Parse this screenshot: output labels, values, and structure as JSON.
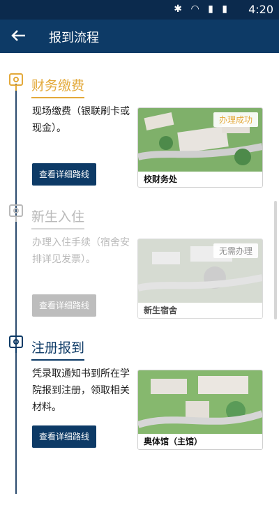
{
  "status_bar": {
    "time": "4:20",
    "icons": [
      "bluetooth-icon",
      "wifi-icon",
      "signal-icon",
      "battery-icon"
    ]
  },
  "app_bar": {
    "title": "报到流程"
  },
  "colors": {
    "primary": "#0d3a66",
    "completed": "#e3a93a",
    "disabled": "#b9b9b9",
    "active": "#0d3a66"
  },
  "steps": [
    {
      "title": "财务缴费",
      "description": "现场缴费（银联刷卡或现金）。",
      "button": "查看详细路线",
      "location": "校财务处",
      "badge": "办理成功",
      "state": "completed"
    },
    {
      "title": "新生入住",
      "description": "办理入住手续（宿舍安排详见发票）。",
      "button": "查看详细路线",
      "location": "新生宿舍",
      "badge": "无需办理",
      "state": "disabled"
    },
    {
      "title": "注册报到",
      "description": "凭录取通知书到所在学院报到注册，领取相关材料。",
      "button": "查看详细路线",
      "location": "奥体馆（主馆）",
      "badge": "",
      "state": "active"
    }
  ]
}
